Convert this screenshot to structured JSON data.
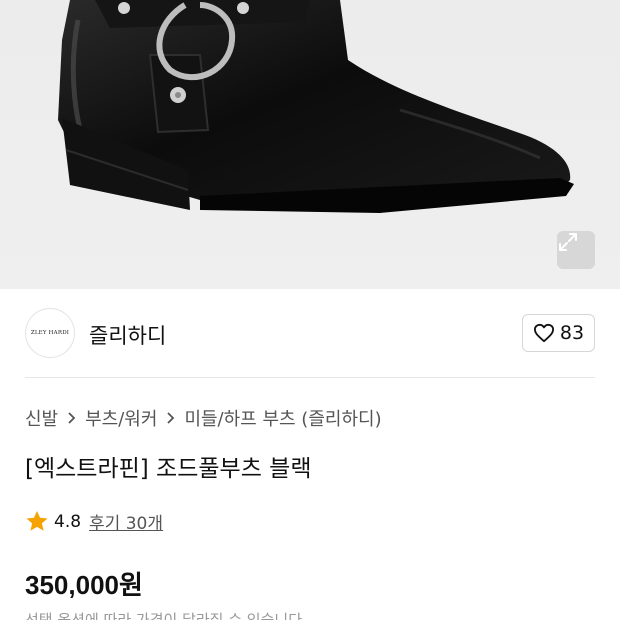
{
  "brand": {
    "logo_text": "ZLEY HARDI",
    "name": "즐리하디"
  },
  "like": {
    "count": "83",
    "icon": "heart-outline-icon"
  },
  "breadcrumb": [
    "신발",
    "부츠/워커",
    "미들/하프 부츠 (즐리하디)"
  ],
  "product": {
    "title": "[엑스트라핀] 조드풀부츠 블랙",
    "rating": "4.8",
    "review_link": "후기 30개",
    "price": "350,000원",
    "price_note": "선택 옵션에 따라 가격이 달라질 수 있습니다"
  },
  "icons": {
    "expand": "expand-arrows-icon",
    "star": "star-icon",
    "chevron": "chevron-right-icon"
  },
  "colors": {
    "star": "#f5a300",
    "text": "#111111",
    "muted": "#999999"
  }
}
